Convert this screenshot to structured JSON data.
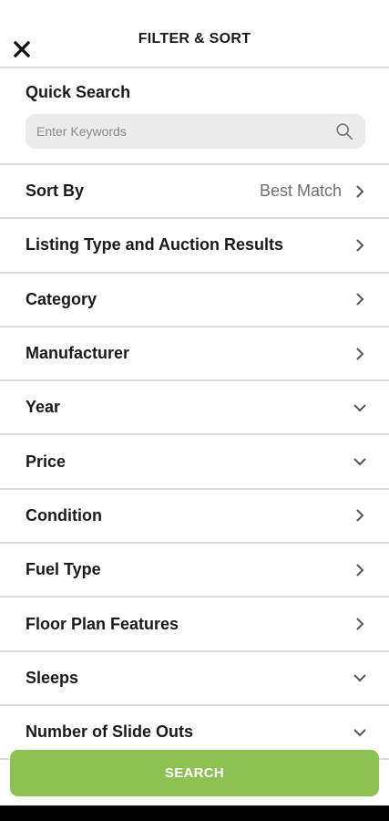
{
  "header": {
    "title": "FILTER & SORT",
    "close_icon": "close-icon"
  },
  "quick_search": {
    "label": "Quick Search",
    "placeholder": "Enter Keywords",
    "value": "",
    "icon": "search-icon"
  },
  "filters": [
    {
      "label": "Sort By",
      "value": "Best Match",
      "icon": "chevron-right-icon"
    },
    {
      "label": "Listing Type and Auction Results",
      "value": "",
      "icon": "chevron-right-icon"
    },
    {
      "label": "Category",
      "value": "",
      "icon": "chevron-right-icon"
    },
    {
      "label": "Manufacturer",
      "value": "",
      "icon": "chevron-right-icon"
    },
    {
      "label": "Year",
      "value": "",
      "icon": "chevron-down-icon"
    },
    {
      "label": "Price",
      "value": "",
      "icon": "chevron-down-icon"
    },
    {
      "label": "Condition",
      "value": "",
      "icon": "chevron-right-icon"
    },
    {
      "label": "Fuel Type",
      "value": "",
      "icon": "chevron-right-icon"
    },
    {
      "label": "Floor Plan Features",
      "value": "",
      "icon": "chevron-right-icon"
    },
    {
      "label": "Sleeps",
      "value": "",
      "icon": "chevron-down-icon"
    },
    {
      "label": "Number of Slide Outs",
      "value": "",
      "icon": "chevron-down-icon"
    }
  ],
  "search_button": {
    "label": "SEARCH"
  },
  "colors": {
    "accent": "#8dc153",
    "divider": "#d9d9d9",
    "search_bg": "#ececec",
    "text": "#1a1a1a",
    "muted": "#6e6e6e"
  }
}
